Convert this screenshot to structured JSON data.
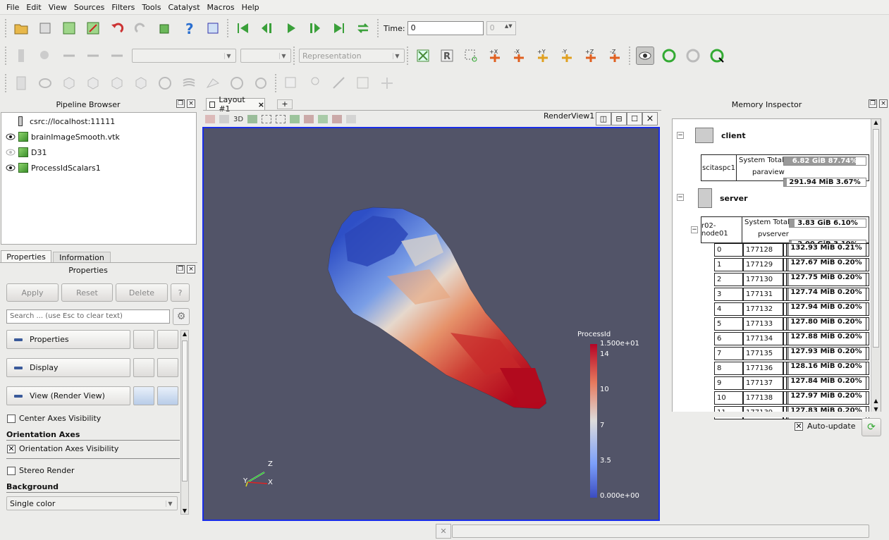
{
  "menu": [
    "File",
    "Edit",
    "View",
    "Sources",
    "Filters",
    "Tools",
    "Catalyst",
    "Macros",
    "Help"
  ],
  "toolbar": {
    "time_label": "Time:",
    "time_value": "0",
    "time_step": "0",
    "representation": "Representation"
  },
  "axis_buttons": [
    "+X",
    "-X",
    "+Y",
    "-Y",
    "+Z",
    "-Z"
  ],
  "pipeline": {
    "title": "Pipeline Browser",
    "server": "csrc://localhost:11111",
    "items": [
      "brainImageSmooth.vtk",
      "D31",
      "ProcessIdScalars1"
    ]
  },
  "tabs": {
    "properties": "Properties",
    "information": "Information"
  },
  "properties": {
    "title": "Properties",
    "apply": "Apply",
    "reset": "Reset",
    "delete": "Delete",
    "help": "?",
    "search_placeholder": "Search ... (use Esc to clear text)",
    "sections": [
      "Properties",
      "Display",
      "View (Render View)"
    ],
    "center_axes": "Center Axes Visibility",
    "orientation_axes_header": "Orientation Axes",
    "orientation_axes": "Orientation Axes Visibility",
    "stereo_render": "Stereo Render",
    "background_header": "Background",
    "background_value": "Single color"
  },
  "layout": {
    "tab": "Layout #1",
    "add_tab": "+",
    "view_name": "RenderView1",
    "three_d": "3D"
  },
  "colorbar": {
    "title": "ProcessId",
    "max": "1.500e+01",
    "min": "0.000e+00",
    "ticks": [
      "14",
      "10",
      "7",
      "3.5"
    ]
  },
  "axes": {
    "z": "Z",
    "x": "X",
    "y": "Y"
  },
  "memory": {
    "title": "Memory Inspector",
    "client": "client",
    "server": "server",
    "client_host": "scitaspc1",
    "system_total": "System Total",
    "client_sys": "6.82 GiB 87.74%",
    "client_sys_frac": 0.8774,
    "paraview": "paraview",
    "client_pv": "291.94 MiB 3.67%",
    "client_pv_frac": 0.0367,
    "server_host": "r02-node01",
    "server_sys": "3.83 GiB 6.10%",
    "server_sys_frac": 0.061,
    "pvserver": "pvserver",
    "server_pv": "2.00 GiB 3.19%",
    "server_pv_frac": 0.0319,
    "ranks": [
      [
        "0",
        "177128",
        "132.93 MiB 0.21%"
      ],
      [
        "1",
        "177129",
        "127.67 MiB 0.20%"
      ],
      [
        "2",
        "177130",
        "127.75 MiB 0.20%"
      ],
      [
        "3",
        "177131",
        "127.74 MiB 0.20%"
      ],
      [
        "4",
        "177132",
        "127.94 MiB 0.20%"
      ],
      [
        "5",
        "177133",
        "127.80 MiB 0.20%"
      ],
      [
        "6",
        "177134",
        "127.88 MiB 0.20%"
      ],
      [
        "7",
        "177135",
        "127.93 MiB 0.20%"
      ],
      [
        "8",
        "177136",
        "128.16 MiB 0.20%"
      ],
      [
        "9",
        "177137",
        "127.84 MiB 0.20%"
      ],
      [
        "10",
        "177138",
        "127.97 MiB 0.20%"
      ],
      [
        "11",
        "177139",
        "127.83 MiB 0.20%"
      ]
    ],
    "auto_update": "Auto-update"
  },
  "colors": {
    "viewport": "#525468",
    "accent": "#1a2ee8"
  }
}
